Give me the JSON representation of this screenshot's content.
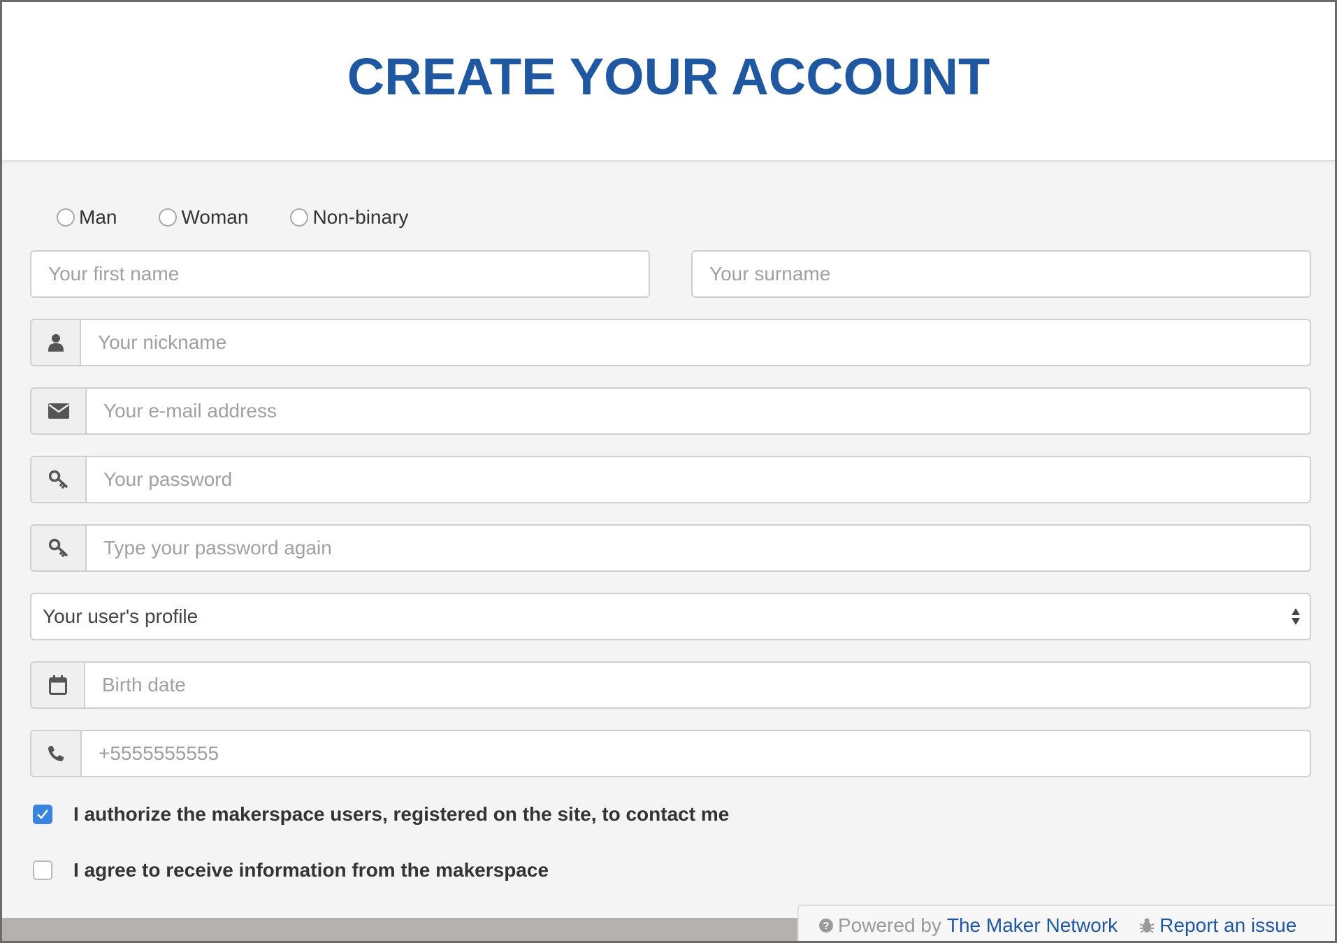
{
  "header": {
    "title": "CREATE YOUR ACCOUNT"
  },
  "gender": {
    "options": [
      {
        "label": "Man"
      },
      {
        "label": "Woman"
      },
      {
        "label": "Non-binary"
      }
    ]
  },
  "fields": {
    "first_name": {
      "placeholder": "Your first name"
    },
    "surname": {
      "placeholder": "Your surname"
    },
    "nickname": {
      "placeholder": "Your nickname",
      "icon": "user-icon"
    },
    "email": {
      "placeholder": "Your e-mail address",
      "icon": "envelope-icon"
    },
    "password": {
      "placeholder": "Your password",
      "icon": "key-icon"
    },
    "password_again": {
      "placeholder": "Type your password again",
      "icon": "key-icon"
    },
    "profile": {
      "selected": "Your user's profile"
    },
    "birth_date": {
      "placeholder": "Birth date",
      "icon": "calendar-icon"
    },
    "phone": {
      "placeholder": "+5555555555",
      "icon": "phone-icon"
    }
  },
  "consents": {
    "contact": {
      "label": "I authorize the makerspace users, registered on the site, to contact me",
      "checked": true
    },
    "info": {
      "label": "I agree to receive information from the makerspace",
      "checked": false
    }
  },
  "footer": {
    "powered_prefix": "Powered by",
    "powered_link": "The Maker Network",
    "report_link": "Report an issue"
  },
  "colors": {
    "title": "#1f58a0",
    "checkbox_checked": "#3a84e0",
    "link": "#1f58a0"
  }
}
